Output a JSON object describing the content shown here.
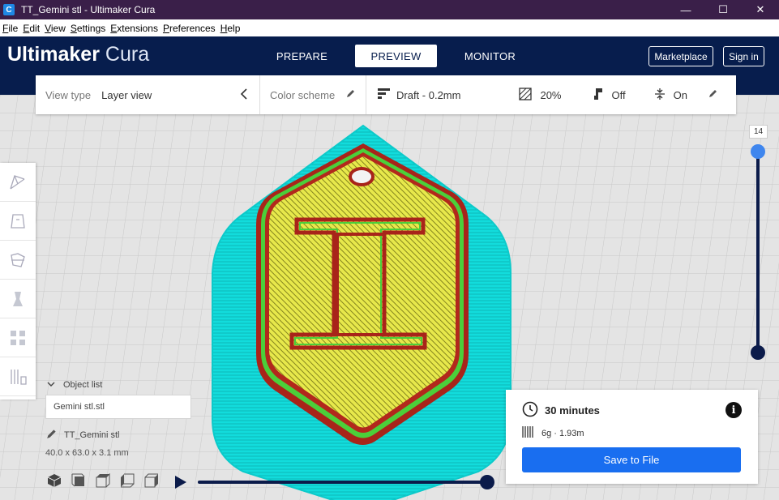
{
  "window": {
    "title": "TT_Gemini stl - Ultimaker Cura",
    "app_icon_letter": "C",
    "controls": {
      "minimize": "—",
      "maximize": "☐",
      "close": "✕"
    }
  },
  "menu": [
    {
      "label": "File"
    },
    {
      "label": "Edit"
    },
    {
      "label": "View"
    },
    {
      "label": "Settings"
    },
    {
      "label": "Extensions"
    },
    {
      "label": "Preferences"
    },
    {
      "label": "Help"
    }
  ],
  "header": {
    "logo_bold": "Ultimaker",
    "logo_light": "Cura",
    "stages": [
      {
        "label": "PREPARE",
        "active": false
      },
      {
        "label": "PREVIEW",
        "active": true
      },
      {
        "label": "MONITOR",
        "active": false
      }
    ],
    "marketplace_label": "Marketplace",
    "signin_label": "Sign in"
  },
  "settings_bar": {
    "view_type_label": "View type",
    "view_type_value": "Layer view",
    "color_scheme_label": "Color scheme",
    "profile": "Draft - 0.2mm",
    "infill": "20%",
    "support": "Off",
    "adhesion": "On"
  },
  "object_list": {
    "header": "Object list",
    "selected_object": "Gemini stl.stl",
    "job_name": "TT_Gemini stl",
    "dimensions": "40.0 x 63.0 x 3.1 mm"
  },
  "layer_slider": {
    "current_layer": "14"
  },
  "simulation": {
    "progress": 1.0
  },
  "print_info": {
    "time": "30 minutes",
    "material": "6g · 1.93m",
    "save_label": "Save to File"
  },
  "colors": {
    "header_bg": "#071d4d",
    "titlebar_bg": "#3a1f49",
    "accent_blue": "#196ef0",
    "skirt_cyan": "#10dede",
    "infill_yellow": "#e8e84a",
    "wall_red": "#b0271a",
    "wall_green": "#4bcf3a"
  }
}
